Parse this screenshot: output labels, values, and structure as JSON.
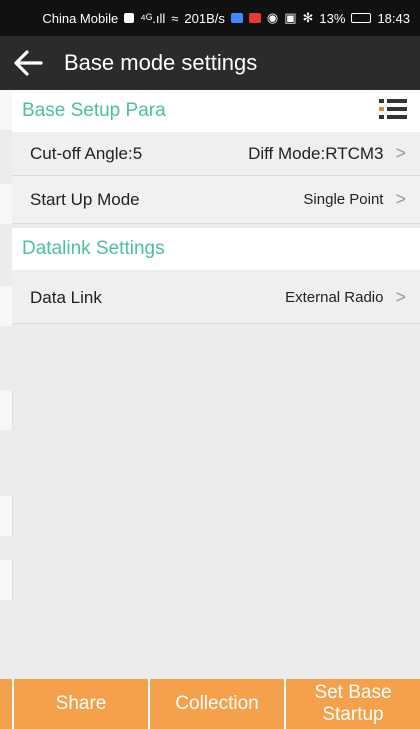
{
  "status_bar": {
    "carrier": "China Mobile",
    "signal_text": "⁴ᴳ.ıll",
    "speed": "201B/s",
    "battery": "13%",
    "time": "18:43"
  },
  "app_bar": {
    "title": "Base mode settings",
    "back_icon": "arrow-left-icon"
  },
  "sections": {
    "base_setup": {
      "title": "Base Setup Para",
      "menu_icon": "list-menu-icon"
    },
    "datalink": {
      "title": "Datalink Settings"
    }
  },
  "rows": {
    "cutoff": {
      "label": "Cut-off Angle:5",
      "value": "Diff Mode:RTCM3",
      "chevron": ">"
    },
    "startup": {
      "label": "Start Up Mode",
      "value": "Single Point",
      "chevron": ">"
    },
    "datalink": {
      "label": "Data Link",
      "value": "External Radio",
      "chevron": ">"
    }
  },
  "buttons": {
    "share": "Share",
    "collection": "Collection",
    "set_base_line1": "Set Base",
    "set_base_line2": "Startup"
  },
  "colors": {
    "accent_teal": "#4bbfa3",
    "button_orange": "#f5a04a",
    "appbar": "#2b2b2b"
  }
}
